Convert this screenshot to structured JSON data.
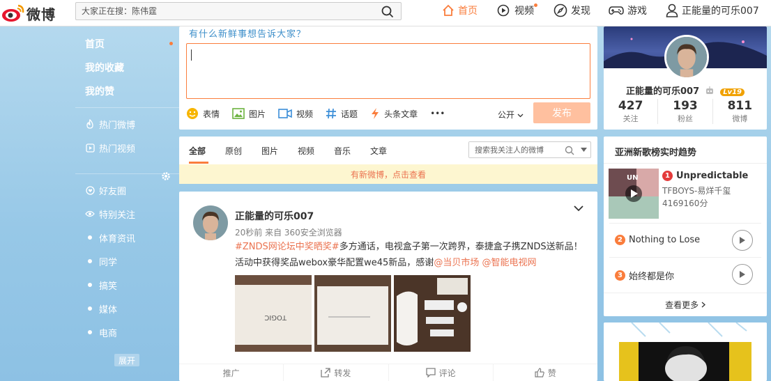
{
  "header": {
    "logo_text": "微博",
    "search_placeholder": "大家正在搜：陈伟霆",
    "nav": [
      {
        "label": "首页",
        "icon": "home-icon"
      },
      {
        "label": "视频",
        "icon": "video-icon"
      },
      {
        "label": "发现",
        "icon": "compass-icon"
      },
      {
        "label": "游戏",
        "icon": "gamepad-icon"
      },
      {
        "label": "正能量的可乐007",
        "icon": "user-icon"
      }
    ]
  },
  "sidebar": {
    "items": [
      {
        "label": "首页"
      },
      {
        "label": "我的收藏"
      },
      {
        "label": "我的赞"
      },
      {
        "label": "热门微博"
      },
      {
        "label": "热门视频"
      },
      {
        "label": "好友圈"
      },
      {
        "label": "特别关注"
      },
      {
        "label": "体育资讯"
      },
      {
        "label": "同学"
      },
      {
        "label": "搞笑"
      },
      {
        "label": "媒体"
      },
      {
        "label": "电商"
      }
    ],
    "expand_label": "展开"
  },
  "publisher": {
    "prompt": "有什么新鲜事想告诉大家？",
    "tools": [
      {
        "label": "表情",
        "icon": "emoji-icon"
      },
      {
        "label": "图片",
        "icon": "image-icon"
      },
      {
        "label": "视频",
        "icon": "video-icon"
      },
      {
        "label": "话题",
        "icon": "hashtag-icon"
      },
      {
        "label": "头条文章",
        "icon": "lightning-icon"
      }
    ],
    "more": "•••",
    "visibility": "公开",
    "submit_label": "发布"
  },
  "feed_tabs": {
    "tabs": [
      "全部",
      "原创",
      "图片",
      "视频",
      "音乐",
      "文章"
    ],
    "active": "全部",
    "search_placeholder": "搜索我关注人的微博"
  },
  "notice": "有新微博，点击查看",
  "post": {
    "author": "正能量的可乐007",
    "meta": "20秒前 来自 360安全浏览器",
    "topic": "#ZNDS网论坛中奖晒奖#",
    "text_a": "多方通话，电视盒子第一次跨界，泰捷盒子携ZNDS送新品！活动中获得奖品webox豪华配置we45新品，感谢",
    "mention1": "@当贝市场",
    "mention2": "@智能电视网",
    "actions": [
      {
        "label": "推广",
        "icon": "promote-icon"
      },
      {
        "label": "转发",
        "icon": "share-icon"
      },
      {
        "label": "评论",
        "icon": "comment-icon"
      },
      {
        "label": "赞",
        "icon": "thumbs-up-icon"
      }
    ]
  },
  "profile": {
    "name": "正能量的可乐007",
    "level": "Lv19",
    "stats": [
      {
        "num": "427",
        "label": "关注"
      },
      {
        "num": "193",
        "label": "粉丝"
      },
      {
        "num": "811",
        "label": "微博"
      }
    ]
  },
  "music": {
    "title": "亚洲新歌榜实时趋势",
    "cover_text": "UN",
    "songs": [
      {
        "rank": "1",
        "name": "Unpredictable",
        "artist": "TFBOYS-易烊千玺",
        "score": "4169160分"
      },
      {
        "rank": "2",
        "name": "Nothing to Lose"
      },
      {
        "rank": "3",
        "name": "始终都是你"
      }
    ],
    "more": "查看更多"
  },
  "colors": {
    "accent": "#fa7d3c",
    "link": "#eb7350",
    "publish_button": "#ffc09f"
  }
}
